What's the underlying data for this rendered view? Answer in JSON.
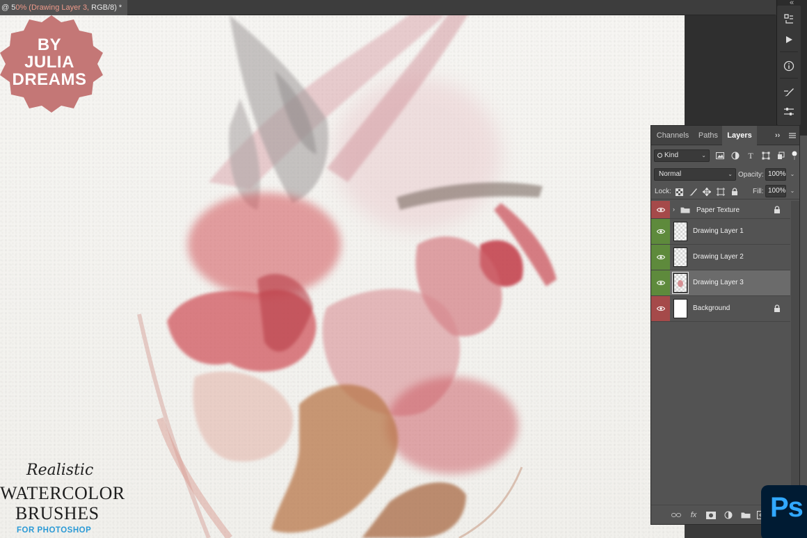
{
  "document_tab": {
    "title_prefix": "@ 5",
    "title_highlight": "0% (Drawing Layer 3,",
    "title_suffix": " RGB/8) *"
  },
  "badge": {
    "line1": "BY",
    "line2": "JULIA",
    "line3": "DREAMS",
    "color": "#c47776"
  },
  "promo": {
    "line1": "Realistic",
    "line2": "WATERCOLOR",
    "line3": "BRUSHES",
    "line4": "FOR PHOTOSHOP",
    "accent": "#2a9ad6"
  },
  "tool_strip": {
    "icons": [
      "history-icon",
      "play-icon",
      "info-icon",
      "brush-settings-icon",
      "adjustments-icon"
    ]
  },
  "layers_panel": {
    "tabs": [
      {
        "label": "Channels",
        "active": false
      },
      {
        "label": "Paths",
        "active": false
      },
      {
        "label": "Layers",
        "active": true
      }
    ],
    "filter": {
      "kind_label": "Kind"
    },
    "blend_mode": "Normal",
    "opacity_label": "Opacity:",
    "opacity_value": "100%",
    "lock_label": "Lock:",
    "fill_label": "Fill:",
    "fill_value": "100%",
    "layers": [
      {
        "name": "Paper Texture",
        "type": "group",
        "visible": true,
        "locked": true,
        "color_tag": "#a54a4a"
      },
      {
        "name": "Drawing Layer 1",
        "type": "pixel",
        "visible": true,
        "locked": false,
        "color_tag": "#5e8a3c"
      },
      {
        "name": "Drawing Layer 2",
        "type": "pixel",
        "visible": true,
        "locked": false,
        "color_tag": "#5e8a3c"
      },
      {
        "name": "Drawing Layer 3",
        "type": "pixel",
        "visible": true,
        "locked": false,
        "selected": true,
        "color_tag": "#5e8a3c"
      },
      {
        "name": "Background",
        "type": "background",
        "visible": true,
        "locked": true,
        "color_tag": "#a54a4a"
      }
    ]
  },
  "app_logo": {
    "text": "Ps"
  }
}
